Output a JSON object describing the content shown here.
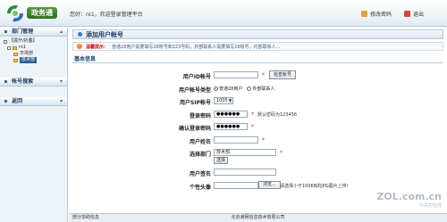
{
  "app": {
    "logo_text": "政务通",
    "welcome": "您好：rx1，欢迎登录管理平台",
    "change_password": "修改密码",
    "logout": "退出"
  },
  "sidebar": {
    "dept_header": "部门管理",
    "dept_nav": "【展开/折叠】",
    "tree": [
      {
        "label": "rx1",
        "level": 1
      },
      {
        "label": "市场部",
        "level": 2
      },
      {
        "label": "技术部",
        "level": 2,
        "selected": true
      }
    ],
    "account_header": "帐号搜索",
    "back_header": "返回"
  },
  "main": {
    "title": "添加用户帐号",
    "tip_label": "温馨提示：",
    "tip_text": "普通28用户需要填写28账号和223号码，外部联系人需要填写28账号，内部联系人...",
    "section": "基本信息",
    "fields": {
      "account_label": "用户ID帐号",
      "account_value": "",
      "check_button": "检查帐号",
      "type_label": "用户帐号类型",
      "type_options": [
        "普通28用户",
        "外部联系人"
      ],
      "sip_label": "用户SIP帐号",
      "sip_value": "1005",
      "password_label": "登录密码",
      "password_value": "●●●●●●",
      "password_hint": "默认密码为123456",
      "confirm_label": "确认登录密码",
      "confirm_value": "●●●●●●",
      "name_label": "用户姓名",
      "name_value": "",
      "dept_label": "选择部门",
      "dept_value": "技术部,",
      "dept_button": "选择",
      "sign_label": "用户签名",
      "sign_value": "",
      "avatar_label": "个性头像",
      "browse_button": "浏览...",
      "avatar_hint": "请选择小于100KB的JPG图片上传!"
    }
  },
  "footer": {
    "left": "部分协助信息",
    "text": "北京通网信息技术有限公司"
  },
  "watermark": {
    "main": "ZOL.com.cn",
    "sub": "中关村在线"
  }
}
